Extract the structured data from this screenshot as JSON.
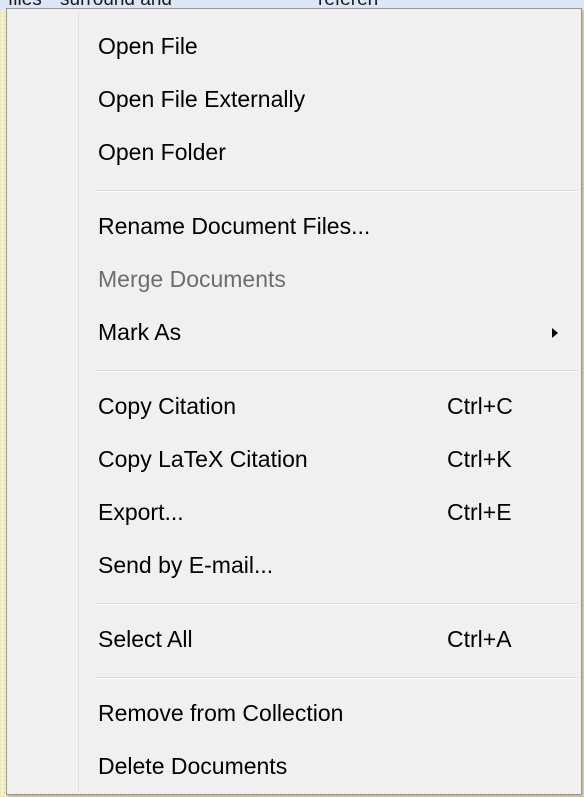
{
  "background_row": {
    "col1": "files",
    "col2": "surround and",
    "col3": "referen"
  },
  "context_menu": {
    "items": [
      {
        "label": "Open File",
        "shortcut": "",
        "disabled": false
      },
      {
        "label": "Open File Externally",
        "shortcut": "",
        "disabled": false
      },
      {
        "label": "Open Folder",
        "shortcut": "",
        "disabled": false
      },
      {
        "label": "Rename Document Files...",
        "shortcut": "",
        "disabled": false
      },
      {
        "label": "Merge Documents",
        "shortcut": "",
        "disabled": true
      },
      {
        "label": "Mark As",
        "shortcut": "",
        "disabled": false,
        "has_submenu": true,
        "submenu_icon": "submenu-arrow-icon"
      },
      {
        "label": "Copy Citation",
        "shortcut": "Ctrl+C",
        "disabled": false
      },
      {
        "label": "Copy LaTeX Citation",
        "shortcut": "Ctrl+K",
        "disabled": false
      },
      {
        "label": "Export...",
        "shortcut": "Ctrl+E",
        "disabled": false
      },
      {
        "label": "Send by E-mail...",
        "shortcut": "",
        "disabled": false
      },
      {
        "label": "Select All",
        "shortcut": "Ctrl+A",
        "disabled": false
      },
      {
        "label": "Remove from Collection",
        "shortcut": "",
        "disabled": false
      },
      {
        "label": "Delete Documents",
        "shortcut": "",
        "disabled": false
      }
    ]
  },
  "colors": {
    "menu_background": "#f0f0f0",
    "menu_border": "#979797",
    "text": "#000000",
    "disabled_text": "#6d6d6d",
    "page_background": "#f7f2c7",
    "row_highlight": "#dce6f5"
  }
}
